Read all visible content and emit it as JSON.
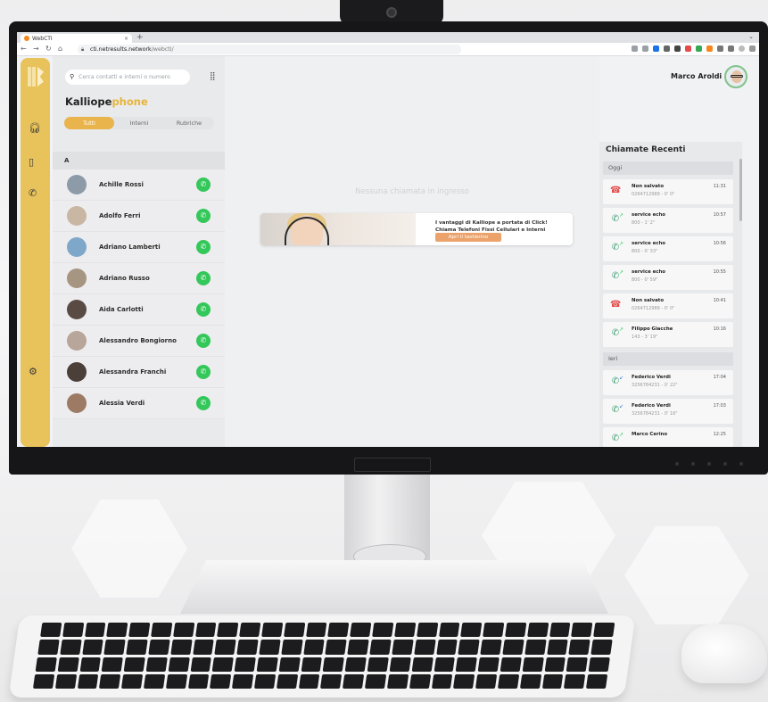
{
  "browser": {
    "tab_title": "WebCTI",
    "tab_close": "×",
    "new_tab": "+",
    "url_domain": "cti.netresults.network",
    "url_path": "/webcti/"
  },
  "app": {
    "search_placeholder": "Cerca contatti e interni o numero",
    "brand_main": "Kalliope",
    "brand_accent": "phone",
    "filters": [
      "Tutti",
      "Interni",
      "Rubriche"
    ],
    "alpha_header": "A",
    "contacts": [
      "Achille Rossi",
      "Adolfo Ferri",
      "Adriano Lamberti",
      "Adriano Russo",
      "Aida Carlotti",
      "Alessandro Bongiorno",
      "Alessandra Franchi",
      "Alessia Verdi"
    ],
    "no_incoming": "Nessuna chiamata in ingresso",
    "promo_line1": "I vantaggi di Kalliope a portata di Click!",
    "promo_line2": "Chiama Telefoni Fissi Cellulari e Interni",
    "promo_button": "Apri il tastierino",
    "user_name": "Marco Aroldi",
    "recent_title": "Chiamate Recenti",
    "day_today": "Oggi",
    "day_yesterday": "Ieri",
    "calls_today": [
      {
        "name": "Non salvato",
        "detail": "0264712989 - 0' 0\"",
        "time": "11:31",
        "kind": "missed"
      },
      {
        "name": "service echo",
        "detail": "800 - 1' 2\"",
        "time": "10:57",
        "kind": "outgoing"
      },
      {
        "name": "service echo",
        "detail": "800 - 0' 33\"",
        "time": "10:56",
        "kind": "outgoing"
      },
      {
        "name": "service echo",
        "detail": "800 - 0' 59\"",
        "time": "10:55",
        "kind": "outgoing"
      },
      {
        "name": "Non salvato",
        "detail": "0264712989 - 0' 0\"",
        "time": "10:41",
        "kind": "missed"
      },
      {
        "name": "Filippo Giacche",
        "detail": "143 - 3' 19\"",
        "time": "10:16",
        "kind": "outgoing"
      }
    ],
    "calls_yesterday": [
      {
        "name": "Federico Verdi",
        "detail": "3256784231 - 0' 22\"",
        "time": "17:04",
        "kind": "incoming"
      },
      {
        "name": "Federico Verdi",
        "detail": "3256784231 - 0' 16\"",
        "time": "17:03",
        "kind": "incoming"
      },
      {
        "name": "Marco Cerino",
        "detail": "",
        "time": "12:25",
        "kind": "outgoing"
      }
    ]
  },
  "colors": {
    "accent": "#e8c25a",
    "call_green": "#34c759",
    "missed_red": "#e44b4b"
  },
  "icons": {
    "search": "search-icon",
    "dialpad": "dialpad-icon",
    "headset": "headset-icon",
    "addressbook": "addressbook-icon",
    "history": "call-history-icon",
    "settings": "gear-icon",
    "phone": "phone-icon"
  }
}
